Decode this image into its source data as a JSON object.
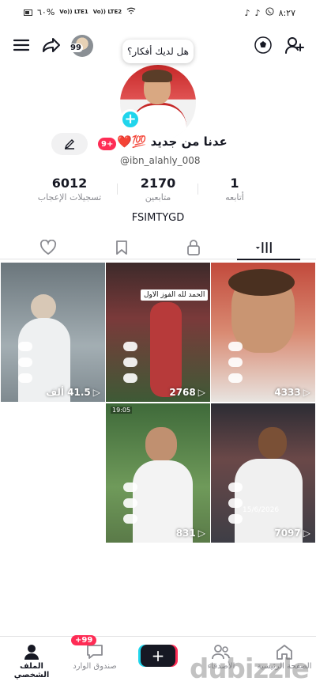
{
  "status_bar": {
    "time": "٨:٢٧",
    "battery": "٦٠%",
    "net1": "Vo)) LTE1",
    "net2": "Vo)) LTE2"
  },
  "profile": {
    "bubble_text": "هل لديك أفكار؟",
    "mini_badge": "99",
    "display_name": "عدنا من جديد 💯❤️",
    "name_badge": "9+",
    "username": "@ibn_alahly_008",
    "bio": "FSIMTYGD"
  },
  "stats": [
    {
      "num": "6012",
      "label": "تسجيلات الإعجاب"
    },
    {
      "num": "2170",
      "label": "متابعين"
    },
    {
      "num": "1",
      "label": "أتابعه"
    }
  ],
  "videos": [
    {
      "views": "41.5 ألف",
      "pinned": "",
      "date": "",
      "time": "",
      "bg": "#8f9aa0"
    },
    {
      "views": "2768",
      "pinned": "الحمد لله الفوز الاول",
      "date": "",
      "time": "",
      "bg": "#5b3030"
    },
    {
      "views": "4333",
      "pinned": "",
      "date": "",
      "time": "",
      "bg": "#b86a55"
    },
    {
      "views": "831",
      "pinned": "",
      "date": "",
      "time": "19:05",
      "bg": "#5c7a4a"
    },
    {
      "views": "7097",
      "pinned": "",
      "date": "15/6/2026",
      "time": "",
      "bg": "#4a4a52"
    }
  ],
  "nav": {
    "home": "الصفحة الرئيسية",
    "friends": "الأصدقاء",
    "inbox": "صندوق الوارد",
    "inbox_badge": "+99",
    "profile": "الملف الشخصي"
  },
  "watermark": "dubizzle",
  "colors": {
    "accent": "#fe2c55",
    "cyan": "#20d5ec",
    "text": "#161823"
  }
}
